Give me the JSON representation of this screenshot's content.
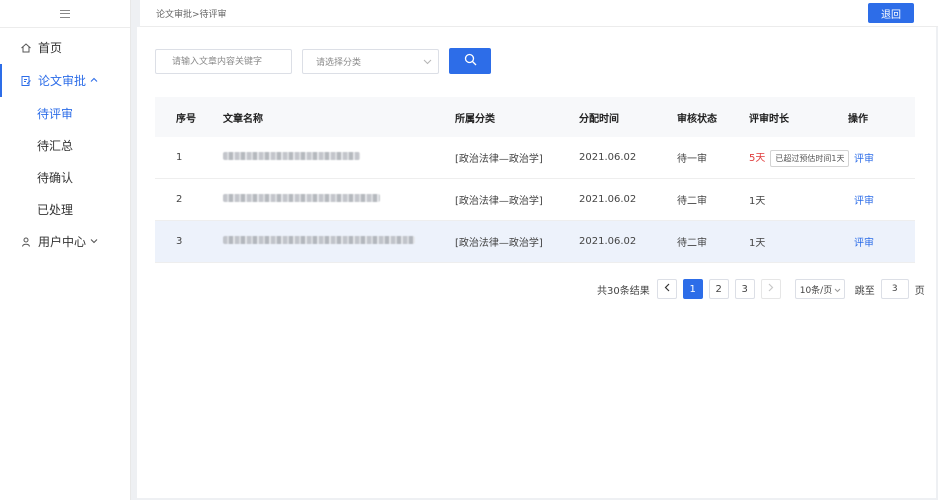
{
  "sidebar": {
    "home_label": "首页",
    "review_label": "论文审批",
    "sub_items": [
      "待评审",
      "待汇总",
      "待确认",
      "已处理"
    ],
    "user_center_label": "用户中心"
  },
  "topbar": {
    "breadcrumb": "论文审批>待评审",
    "back_label": "退回"
  },
  "filters": {
    "search_placeholder": "请输入文章内容关键字",
    "category_placeholder": "请选择分类"
  },
  "table": {
    "headers": [
      "序号",
      "文章名称",
      "所属分类",
      "分配时间",
      "审核状态",
      "评审时长",
      "操作"
    ],
    "rows": [
      {
        "index": "1",
        "category": "[政治法律—政治学]",
        "assigned": "2021.06.02",
        "status": "待一审",
        "duration": "5天",
        "duration_overdue": true,
        "overdue_tag": "已超过预估时间1天",
        "action": "评审"
      },
      {
        "index": "2",
        "category": "[政治法律—政治学]",
        "assigned": "2021.06.02",
        "status": "待二审",
        "duration": "1天",
        "duration_overdue": false,
        "overdue_tag": "",
        "action": "评审"
      },
      {
        "index": "3",
        "category": "[政治法律—政治学]",
        "assigned": "2021.06.02",
        "status": "待二审",
        "duration": "1天",
        "duration_overdue": false,
        "overdue_tag": "",
        "action": "评审"
      }
    ]
  },
  "pagination": {
    "total_text": "共30条结果",
    "pages": [
      "1",
      "2",
      "3"
    ],
    "current_page": "1",
    "page_size": "10条/页",
    "jump_label": "跳至",
    "jump_value": "3",
    "page_suffix": "页"
  },
  "colors": {
    "accent": "#2d6de8",
    "overdue": "#e03b3b",
    "highlight_row": "#edf2fb"
  }
}
